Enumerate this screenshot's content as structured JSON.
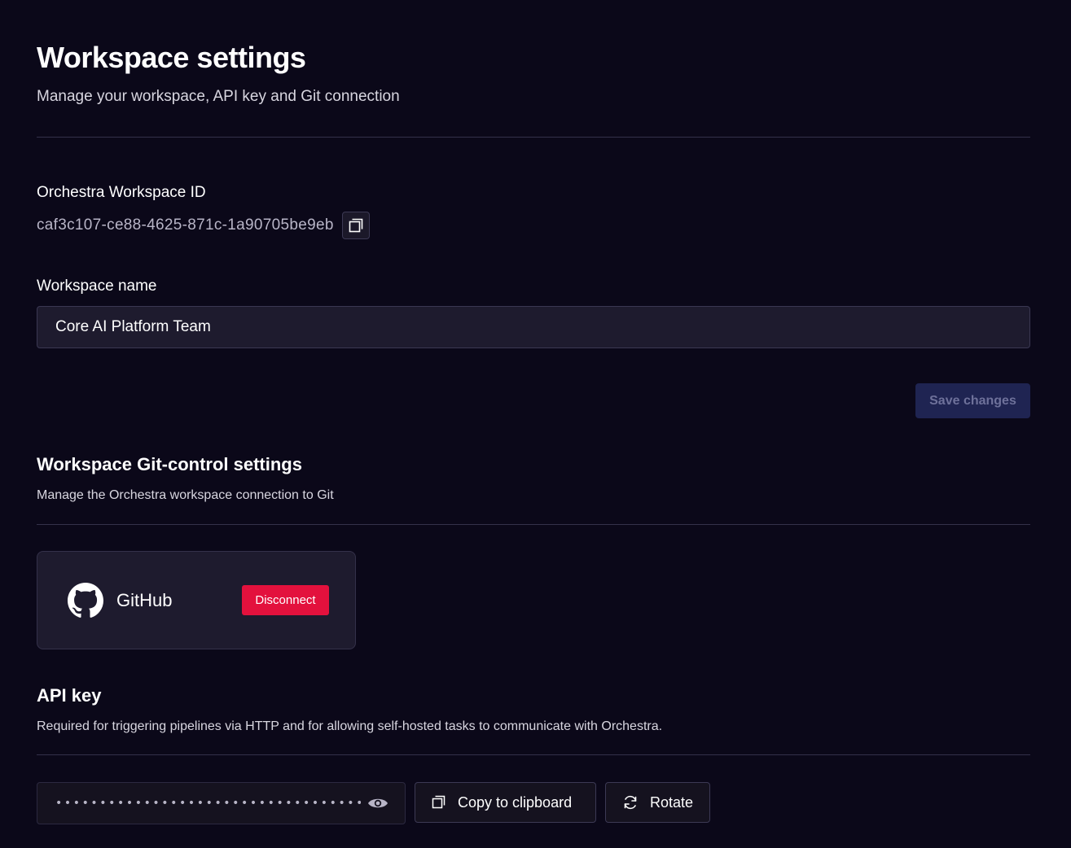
{
  "header": {
    "title": "Workspace settings",
    "subtitle": "Manage your workspace, API key and Git connection"
  },
  "workspace_id": {
    "label": "Orchestra Workspace ID",
    "value": "caf3c107-ce88-4625-871c-1a90705be9eb"
  },
  "workspace_name": {
    "label": "Workspace name",
    "value": "Core AI Platform Team"
  },
  "save_button": {
    "label": "Save changes"
  },
  "git_section": {
    "title": "Workspace Git-control settings",
    "description": "Manage the Orchestra workspace connection to Git",
    "provider": "GitHub",
    "disconnect_label": "Disconnect"
  },
  "api_section": {
    "title": "API key",
    "description": "Required for triggering pipelines via HTTP and for allowing self-hosted tasks to communicate with Orchestra.",
    "masked_value": "••••••••••••••••••••••••••••••••••••••••",
    "copy_label": "Copy to clipboard",
    "rotate_label": "Rotate"
  },
  "colors": {
    "background": "#0b0819",
    "disconnect": "#e3113d",
    "save_disabled": "#1f2452"
  },
  "icons": {
    "copy": "copy-icon",
    "github": "github-icon",
    "eye": "eye-icon",
    "rotate": "rotate-icon"
  }
}
